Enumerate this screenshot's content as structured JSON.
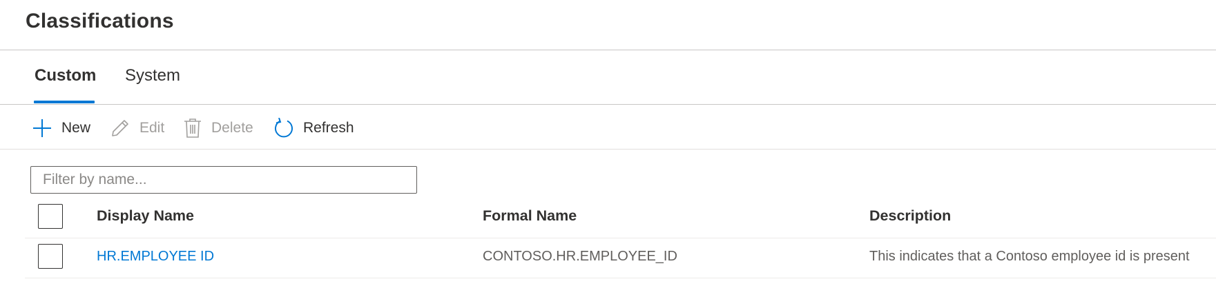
{
  "page": {
    "title": "Classifications"
  },
  "tabs": [
    {
      "label": "Custom",
      "selected": true
    },
    {
      "label": "System",
      "selected": false
    }
  ],
  "toolbar": {
    "new_label": "New",
    "edit_label": "Edit",
    "delete_label": "Delete",
    "refresh_label": "Refresh"
  },
  "filter": {
    "placeholder": "Filter by name...",
    "value": ""
  },
  "table": {
    "columns": [
      "Display Name",
      "Formal Name",
      "Description"
    ],
    "rows": [
      {
        "display_name": "HR.EMPLOYEE ID",
        "formal_name": "CONTOSO.HR.EMPLOYEE_ID",
        "description": "This indicates that a Contoso employee id is present"
      }
    ]
  },
  "colors": {
    "accent": "#0078d4",
    "text": "#323130",
    "disabled": "#a19f9d",
    "border": "#c8c6c4"
  },
  "icons": {
    "new": "plus-icon",
    "edit": "pencil-icon",
    "delete": "trash-icon",
    "refresh": "refresh-icon"
  }
}
